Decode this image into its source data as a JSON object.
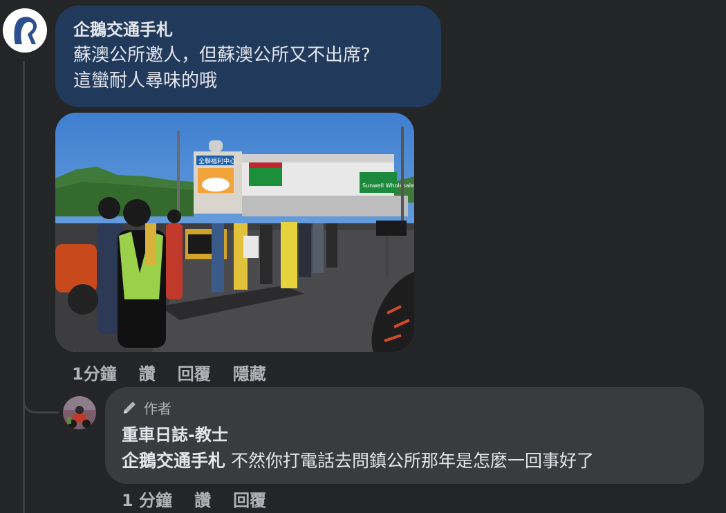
{
  "main_comment": {
    "author": "企鵝交通手札",
    "text_line1": "蘇澳公所邀人，但蘇澳公所又不出席?",
    "text_line2": "這蠻耐人尋味的哦",
    "photo_signs": {
      "sign1": "全聯福利中心",
      "sign2": "Sunwell Wholesale"
    },
    "actions": {
      "time": "1分鐘",
      "like": "讚",
      "reply": "回覆",
      "hide": "隱藏"
    }
  },
  "reply_comment": {
    "badge": "作者",
    "author": "重車日誌-教士",
    "mention": "企鵝交通手札",
    "text": " 不然你打電話去問鎮公所那年是怎麼一回事好了",
    "actions": {
      "time": "1 分鐘",
      "like": "讚",
      "reply": "回覆"
    }
  },
  "colors": {
    "background": "#242526",
    "main_bubble": "#213a5c",
    "reply_bubble": "#3a3b3c",
    "text_primary": "#e4e6eb",
    "text_secondary": "#b0b3b8"
  }
}
